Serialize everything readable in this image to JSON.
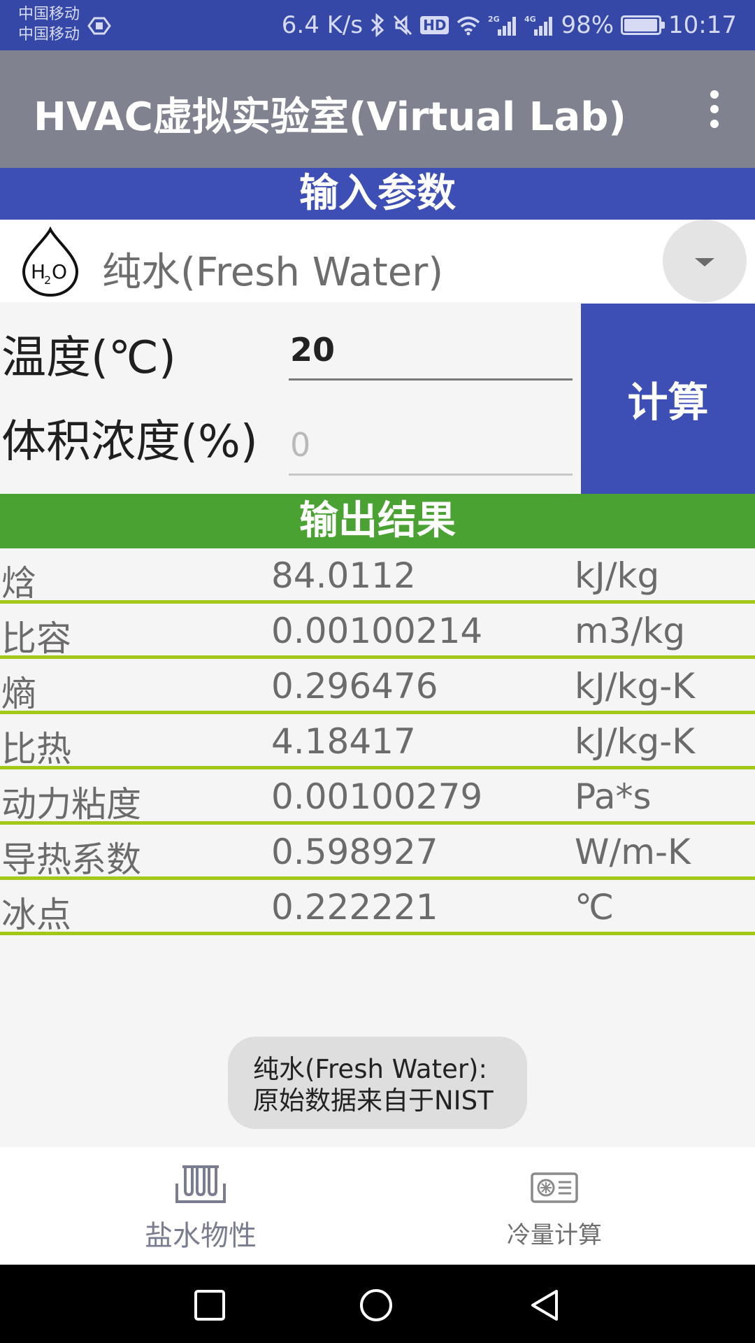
{
  "status_bar": {
    "carrier_1": "中国移动",
    "carrier_2": "中国移动",
    "speed": "6.4 K/s",
    "hd": "HD",
    "battery_percent": "98%",
    "battery_level": 0.98,
    "time": "10:17",
    "icons": [
      "bluetooth-icon",
      "mute-icon",
      "wifi-icon",
      "signal-2g-icon",
      "signal-4g-icon",
      "battery-icon"
    ]
  },
  "app_bar": {
    "title": "HVAC虚拟实验室(Virtual Lab)",
    "menu_icon": "more-vert-icon"
  },
  "input_section": {
    "header": "输入参数",
    "fluid": {
      "selected": "纯水(Fresh Water)",
      "icon": "h2o-drop-icon"
    },
    "temperature": {
      "label": "温度(℃)",
      "value": "20"
    },
    "concentration": {
      "label": "体积浓度(%)",
      "value": "",
      "placeholder": "0"
    },
    "calculate_label": "计算"
  },
  "output_section": {
    "header": "输出结果",
    "rows": [
      {
        "name": "焓",
        "value": "84.0112",
        "unit": "kJ/kg"
      },
      {
        "name": "比容",
        "value": "0.00100214",
        "unit": "m3/kg"
      },
      {
        "name": "熵",
        "value": "0.296476",
        "unit": "kJ/kg-K"
      },
      {
        "name": "比热",
        "value": "4.18417",
        "unit": "kJ/kg-K"
      },
      {
        "name": "动力粘度",
        "value": "0.00100279",
        "unit": "Pa*s"
      },
      {
        "name": "导热系数",
        "value": "0.598927",
        "unit": "W/m-K"
      },
      {
        "name": "冰点",
        "value": "0.222221",
        "unit": "℃"
      }
    ]
  },
  "toast": {
    "line1": "纯水(Fresh Water):",
    "line2": "原始数据来自于NIST"
  },
  "bottom_nav": {
    "items": [
      {
        "label": "盐水物性",
        "icon": "test-tubes-icon",
        "active": true
      },
      {
        "label": "冷量计算",
        "icon": "air-conditioner-icon",
        "active": false
      }
    ]
  },
  "system_nav": {
    "icons": [
      "recent-apps-icon",
      "home-icon",
      "back-icon"
    ]
  },
  "colors": {
    "status_bar": "#3548a8",
    "app_bar": "#80838f",
    "input_header": "#3d4fb5",
    "output_header": "#4aa232",
    "row_divider": "#a3c81a"
  }
}
